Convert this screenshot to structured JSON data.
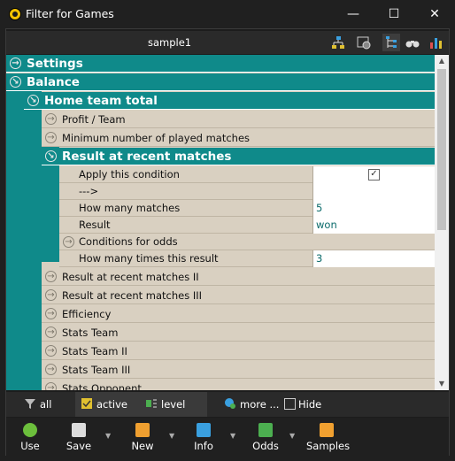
{
  "window": {
    "title": "Filter for Games",
    "minimize": "—",
    "maximize": "☐",
    "close": "✕"
  },
  "toolbar": {
    "name": "sample1"
  },
  "grid": {
    "settings": "Settings",
    "balance": "Balance",
    "home_team_total": "Home team total",
    "profit_team": "Profit / Team",
    "min_played": "Minimum number of played matches",
    "result_recent": "Result at recent matches",
    "apply_condition": "Apply this condition",
    "arrow_row": "--->",
    "how_many_matches": "How many matches",
    "how_many_matches_value": "5",
    "result": "Result",
    "result_value": "won",
    "conditions_odds": "Conditions for odds",
    "how_many_times": "How many times this result",
    "how_many_times_value": "3",
    "result_recent_2": "Result at recent matches II",
    "result_recent_3": "Result at recent matches III",
    "efficiency": "Efficiency",
    "stats_team": "Stats Team",
    "stats_team_2": "Stats Team II",
    "stats_team_3": "Stats Team III",
    "stats_opponent": "Stats Opponent",
    "apply_checked": "✓"
  },
  "filterbar": {
    "all": "all",
    "active": "active",
    "level": "level",
    "more": "more ...",
    "hide": "Hide"
  },
  "bottombar": {
    "use": "Use",
    "save": "Save",
    "new": "New",
    "info": "Info",
    "odds": "Odds",
    "samples": "Samples"
  },
  "colors": {
    "accent": "#0f8a8a",
    "row_bg": "#d9d0c1",
    "value_text": "#0b6b6b"
  }
}
